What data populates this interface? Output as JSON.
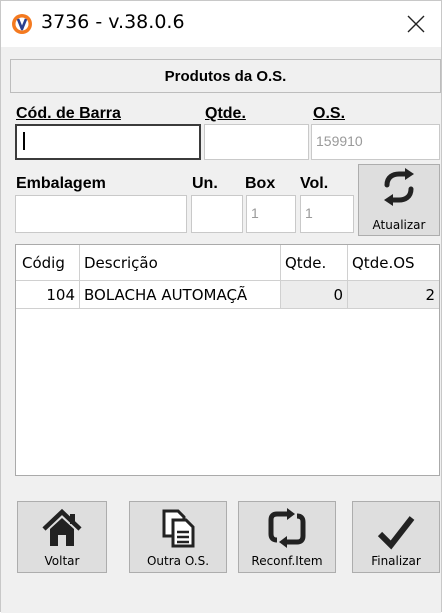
{
  "window": {
    "title": "3736 - v.38.0.6"
  },
  "header": {
    "title": "Produtos da O.S."
  },
  "form": {
    "barcode_label": "Cód. de Barra",
    "barcode_value": "",
    "qty_label": "Qtde.",
    "qty_value": "",
    "os_label": "O.S.",
    "os_value": "159910",
    "packaging_label": "Embalagem",
    "packaging_value": "",
    "unit_label": "Un.",
    "unit_value": "",
    "box_label": "Box",
    "box_value": "1",
    "vol_label": "Vol.",
    "vol_value": "1",
    "refresh_label": "Atualizar"
  },
  "grid": {
    "columns": [
      "Códig",
      "Descrição",
      "Qtde.",
      "Qtde.OS"
    ],
    "rows": [
      {
        "code": "104",
        "description": "BOLACHA AUTOMAÇÃ",
        "qty": "0",
        "qty_os": "2"
      }
    ]
  },
  "buttons": {
    "back": "Voltar",
    "other_os": "Outra O.S.",
    "reconf_item": "Reconf.Item",
    "finish": "Finalizar"
  },
  "colors": {
    "app_icon_orange": "#f47a20",
    "app_icon_blue": "#2a3f8f"
  }
}
